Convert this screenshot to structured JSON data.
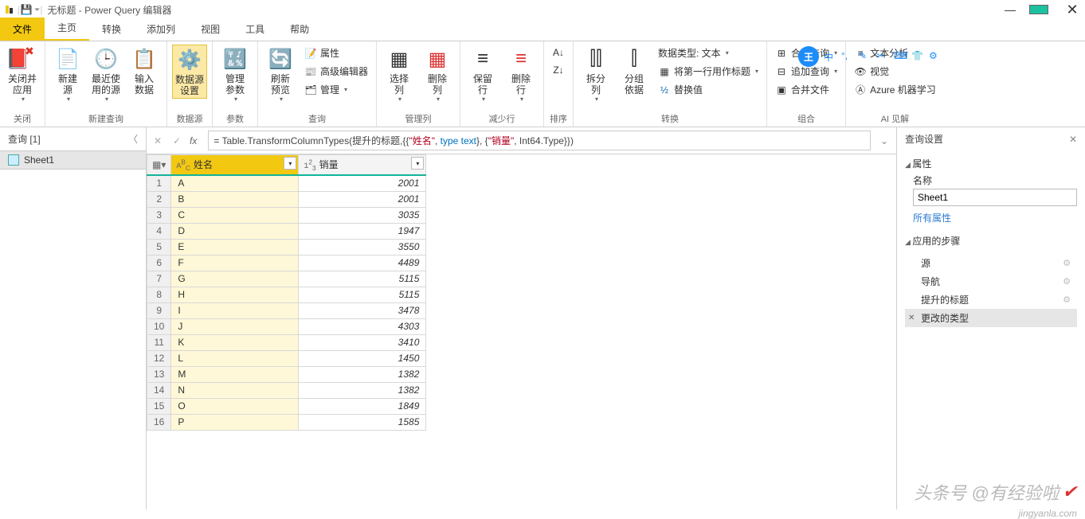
{
  "title": "无标题 - Power Query 编辑器",
  "tabs": {
    "file": "文件",
    "home": "主页",
    "transform": "转换",
    "add": "添加列",
    "view": "视图",
    "tools": "工具",
    "help": "帮助"
  },
  "ribbon": {
    "close": {
      "btn": "关闭并\n应用",
      "label": "关闭"
    },
    "newq": {
      "b1": "新建\n源",
      "b2": "最近使\n用的源",
      "b3": "输入\n数据",
      "label": "新建查询"
    },
    "ds": {
      "b1": "数据源\n设置",
      "label": "数据源"
    },
    "param": {
      "b1": "管理\n参数",
      "label": "参数"
    },
    "query": {
      "b1": "刷新\n预览",
      "s1": "属性",
      "s2": "高级编辑器",
      "s3": "管理",
      "label": "查询"
    },
    "cols": {
      "b1": "选择\n列",
      "b2": "删除\n列",
      "label": "管理列"
    },
    "rows": {
      "b1": "保留\n行",
      "b2": "删除\n行",
      "label": "减少行"
    },
    "sort": {
      "label": "排序"
    },
    "trans": {
      "b1": "拆分\n列",
      "b2": "分组\n依据",
      "s1": "数据类型: 文本",
      "s2": "将第一行用作标题",
      "s3": "替换值",
      "label": "转换"
    },
    "combine": {
      "s1": "合并查询",
      "s2": "追加查询",
      "s3": "合并文件",
      "label": "组合"
    },
    "ai": {
      "s1": "文本分析",
      "s2": "视觉",
      "s3": "Azure 机器学习",
      "label": "AI 见解"
    }
  },
  "queries": {
    "header": "查询 [1]",
    "item": "Sheet1"
  },
  "formula": {
    "prefix": "= Table.TransformColumnTypes(提升的标题,{{",
    "s1": "\"姓名\"",
    "c1": ", ",
    "kw1": "type text",
    "c2": "}, {",
    "s2": "\"销量\"",
    "c3": ", Int64.Type}})"
  },
  "grid": {
    "col1": "姓名",
    "col2": "销量",
    "rows": [
      {
        "n": "1",
        "a": "A",
        "b": "2001"
      },
      {
        "n": "2",
        "a": "B",
        "b": "2001"
      },
      {
        "n": "3",
        "a": "C",
        "b": "3035"
      },
      {
        "n": "4",
        "a": "D",
        "b": "1947"
      },
      {
        "n": "5",
        "a": "E",
        "b": "3550"
      },
      {
        "n": "6",
        "a": "F",
        "b": "4489"
      },
      {
        "n": "7",
        "a": "G",
        "b": "5115"
      },
      {
        "n": "8",
        "a": "H",
        "b": "5115"
      },
      {
        "n": "9",
        "a": "I",
        "b": "3478"
      },
      {
        "n": "10",
        "a": "J",
        "b": "4303"
      },
      {
        "n": "11",
        "a": "K",
        "b": "3410"
      },
      {
        "n": "12",
        "a": "L",
        "b": "1450"
      },
      {
        "n": "13",
        "a": "M",
        "b": "1382"
      },
      {
        "n": "14",
        "a": "N",
        "b": "1382"
      },
      {
        "n": "15",
        "a": "O",
        "b": "1849"
      },
      {
        "n": "16",
        "a": "P",
        "b": "1585"
      }
    ]
  },
  "settings": {
    "header": "查询设置",
    "prop_sect": "属性",
    "name_label": "名称",
    "name_value": "Sheet1",
    "all_props": "所有属性",
    "steps_sect": "应用的步骤",
    "steps": [
      "源",
      "导航",
      "提升的标题",
      "更改的类型"
    ]
  },
  "watermark": "头条号 @有经验啦",
  "wm2": "jingyanla.com"
}
